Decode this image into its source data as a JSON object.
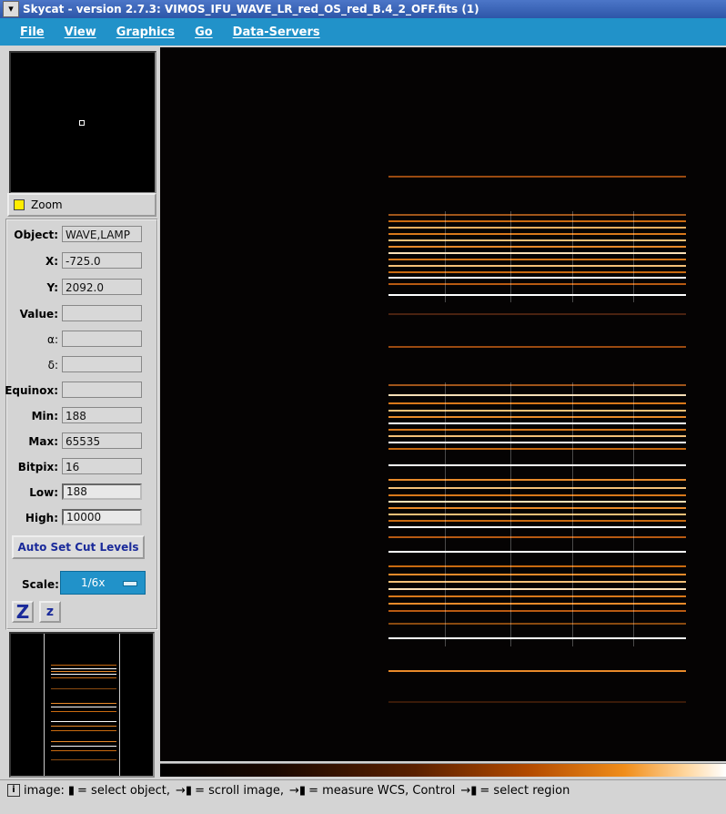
{
  "window": {
    "title": "Skycat - version 2.7.3: VIMOS_IFU_WAVE_LR_red_OS_red_B.4_2_OFF.fits (1)"
  },
  "menubar": {
    "items": [
      "File",
      "View",
      "Graphics",
      "Go",
      "Data-Servers"
    ]
  },
  "panner": {
    "zoom_label": "Zoom"
  },
  "info": {
    "rows": [
      {
        "label": "Object:",
        "value": "WAVE,LAMP"
      },
      {
        "label": "X:",
        "value": "-725.0"
      },
      {
        "label": "Y:",
        "value": "2092.0"
      },
      {
        "label": "Value:",
        "value": ""
      },
      {
        "label": "α:",
        "value": ""
      },
      {
        "label": "δ:",
        "value": ""
      },
      {
        "label": "Equinox:",
        "value": ""
      },
      {
        "label": "Min:",
        "value": "188"
      },
      {
        "label": "Max:",
        "value": "65535"
      },
      {
        "label": "Bitpix:",
        "value": "16"
      },
      {
        "label": "Low:",
        "value": "188"
      },
      {
        "label": "High:",
        "value": "10000"
      }
    ],
    "auto_cut_label": "Auto Set Cut Levels",
    "scale_label": "Scale:",
    "scale_value": "1/6x",
    "zoom_in_label": "Z",
    "zoom_out_label": "z"
  },
  "status": {
    "info_icon": "i",
    "prefix": "image:",
    "segments": [
      "= select object,",
      "= scroll image,",
      "= measure WCS, Control",
      "= select region"
    ]
  },
  "colors": {
    "accent": "#2192c9",
    "title": "#2d56a8",
    "spectrum": "#f08d1a"
  }
}
